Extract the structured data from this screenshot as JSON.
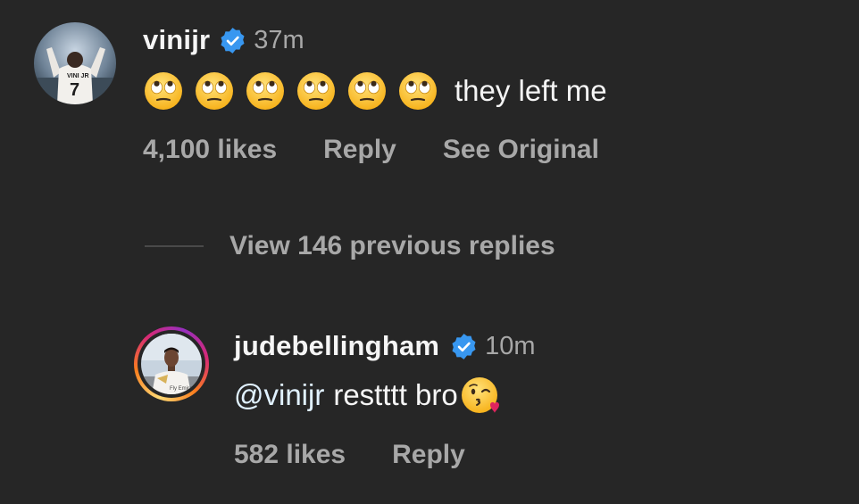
{
  "colors": {
    "background": "#262626",
    "primary_text": "#f5f5f5",
    "secondary_text": "#a8a8a8",
    "verified_blue": "#3897f0",
    "mention_text": "#e0f1ff"
  },
  "comments": [
    {
      "username": "vinijr",
      "verified": true,
      "timestamp": "37m",
      "emojis": [
        "face-with-rolling-eyes",
        "face-with-rolling-eyes",
        "face-with-rolling-eyes",
        "face-with-rolling-eyes",
        "face-with-rolling-eyes",
        "face-with-rolling-eyes"
      ],
      "text": "they left me",
      "likes": "4,100 likes",
      "reply_label": "Reply",
      "see_original_label": "See Original"
    },
    {
      "username": "judebellingham",
      "verified": true,
      "timestamp": "10m",
      "mention": "@vinijr",
      "text": "restttt bro",
      "trailing_emoji": "face-blowing-a-kiss",
      "likes": "582 likes",
      "reply_label": "Reply",
      "has_story_ring": true
    }
  ],
  "replies_toggle": {
    "label": "View 146 previous replies"
  }
}
